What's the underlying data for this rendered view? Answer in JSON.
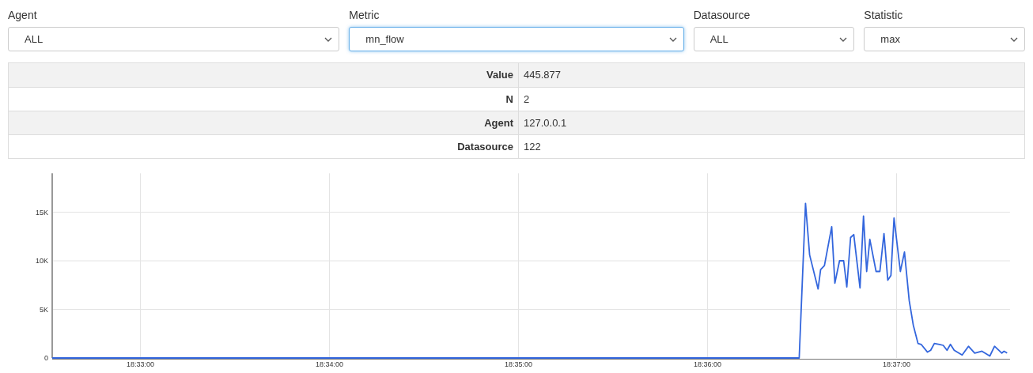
{
  "filters": [
    {
      "label": "Agent",
      "value": "ALL",
      "focused": false
    },
    {
      "label": "Metric",
      "value": "mn_flow",
      "focused": true
    },
    {
      "label": "Datasource",
      "value": "ALL",
      "focused": false
    },
    {
      "label": "Statistic",
      "value": "max",
      "focused": false
    }
  ],
  "summary": [
    {
      "label": "Value",
      "value": "445.877"
    },
    {
      "label": "N",
      "value": "2"
    },
    {
      "label": "Agent",
      "value": "127.0.0.1"
    },
    {
      "label": "Datasource",
      "value": "122"
    }
  ],
  "chart_data": {
    "type": "line",
    "grid": true,
    "xlim": [
      66752,
      67056
    ],
    "ylim": [
      0,
      19000
    ],
    "xticks": [
      {
        "value": 66780,
        "label": "18:33:00"
      },
      {
        "value": 66840,
        "label": "18:34:00"
      },
      {
        "value": 66900,
        "label": "18:35:00"
      },
      {
        "value": 66960,
        "label": "18:36:00"
      },
      {
        "value": 67020,
        "label": "18:37:00"
      }
    ],
    "yticks": [
      {
        "value": 0,
        "label": "0"
      },
      {
        "value": 5000,
        "label": "5K"
      },
      {
        "value": 10000,
        "label": "10K"
      },
      {
        "value": 15000,
        "label": "15K"
      }
    ],
    "x": [
      66752,
      66989.1,
      66991.1,
      66992.4,
      66995.1,
      66995.9,
      66997.1,
      66999.4,
      67000.4,
      67001.9,
      67003.2,
      67004.2,
      67005.4,
      67006.4,
      67008.4,
      67009.5,
      67010.5,
      67011.5,
      67013.5,
      67014.7,
      67016.0,
      67017.2,
      67018.2,
      67019.2,
      67021.2,
      67022.5,
      67024.0,
      67025.3,
      67026.8,
      67027.8,
      67029.8,
      67030.8,
      67032.0,
      67033.6,
      67034.8,
      67036.0,
      67037.1,
      67038.3,
      67040.8,
      67042.8,
      67044.8,
      67047.1,
      67049.6,
      67051.1,
      67053.4,
      67054.1,
      67055.1
    ],
    "series": [
      {
        "color": "#3366dd",
        "values": [
          0,
          0,
          15900,
          10600,
          7100,
          9100,
          9500,
          13500,
          7700,
          10000,
          10000,
          7300,
          12400,
          12700,
          7200,
          14600,
          8900,
          12200,
          8900,
          8900,
          12800,
          8000,
          8500,
          14400,
          8900,
          10900,
          5900,
          3400,
          1500,
          1400,
          600,
          800,
          1500,
          1400,
          1300,
          800,
          1400,
          800,
          300,
          1200,
          500,
          700,
          200,
          1200,
          500,
          700,
          500
        ]
      }
    ]
  }
}
